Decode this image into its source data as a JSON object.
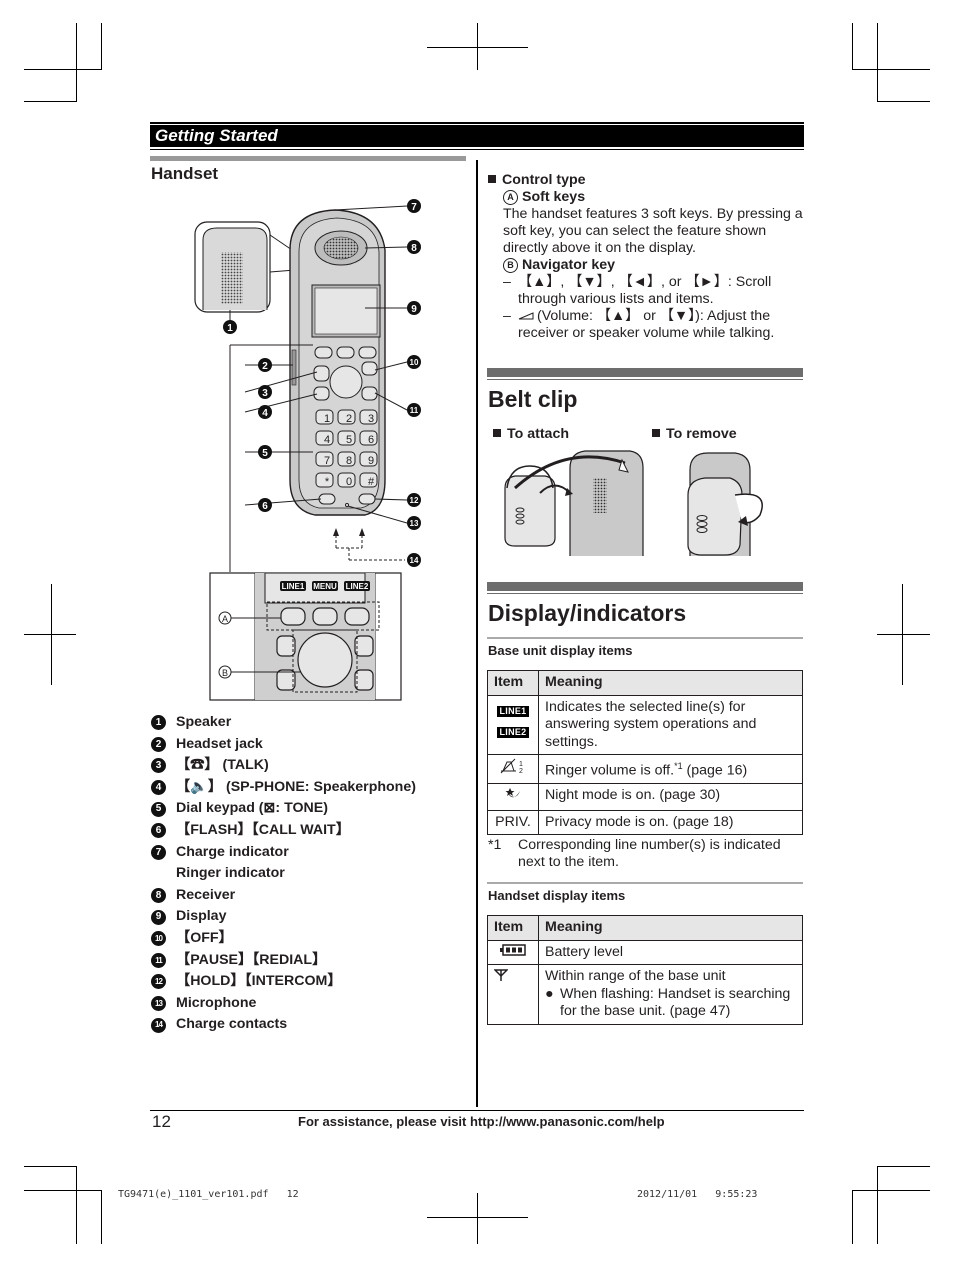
{
  "header": {
    "section": "Getting Started"
  },
  "handset": {
    "title": "Handset",
    "diagram_callouts": [
      "1",
      "2",
      "3",
      "4",
      "5",
      "6",
      "7",
      "8",
      "9",
      "10",
      "11",
      "12",
      "13",
      "14"
    ],
    "inset_labels": {
      "a": "A",
      "b": "B",
      "soft_keys": [
        "LINE1",
        "MENU",
        "LINE2"
      ]
    },
    "parts": [
      {
        "n": "1",
        "label": "Speaker"
      },
      {
        "n": "2",
        "label": "Headset jack"
      },
      {
        "n": "3",
        "label": "【☎】 (TALK)"
      },
      {
        "n": "4",
        "label": "【🔈】 (SP-PHONE: Speakerphone)"
      },
      {
        "n": "5",
        "label": "Dial keypad (⊠: TONE)"
      },
      {
        "n": "6",
        "label": "【FLASH】【CALL WAIT】"
      },
      {
        "n": "7",
        "label": "Charge indicator",
        "label2": "Ringer indicator"
      },
      {
        "n": "8",
        "label": "Receiver"
      },
      {
        "n": "9",
        "label": "Display"
      },
      {
        "n": "10",
        "label": "【OFF】"
      },
      {
        "n": "11",
        "label": "【PAUSE】【REDIAL】"
      },
      {
        "n": "12",
        "label": "【HOLD】【INTERCOM】"
      },
      {
        "n": "13",
        "label": "Microphone"
      },
      {
        "n": "14",
        "label": "Charge contacts"
      }
    ]
  },
  "control_type": {
    "heading": "Control type",
    "soft_keys": {
      "marker": "A",
      "title": "Soft keys",
      "text": "The handset features 3 soft keys. By pressing a soft key, you can select the feature shown directly above it on the display."
    },
    "navigator": {
      "marker": "B",
      "title": "Navigator key",
      "items": [
        "【▲】, 【▼】, 【◄】, or 【►】: Scroll through various lists and items.",
        "(Volume: 【▲】 or 【▼】): Adjust the receiver or speaker volume while talking."
      ]
    }
  },
  "belt_clip": {
    "title": "Belt clip",
    "attach": "To attach",
    "remove": "To remove"
  },
  "display_indicators": {
    "title": "Display/indicators",
    "base_unit": {
      "heading": "Base unit display items",
      "columns": [
        "Item",
        "Meaning"
      ],
      "rows": [
        {
          "item": [
            "LINE1",
            "LINE2"
          ],
          "meaning": "Indicates the selected line(s) for answering system operations and settings."
        },
        {
          "item": "ringer-off-icon",
          "meaning": "Ringer volume is off.",
          "sup": "*1",
          "ref": " (page 16)"
        },
        {
          "item": "night-mode-icon",
          "meaning": "Night mode is on. (page 30)"
        },
        {
          "item": "PRIV.",
          "meaning": "Privacy mode is on. (page 18)"
        }
      ],
      "footnote_mark": "*1",
      "footnote": "Corresponding line number(s) is indicated next to the item."
    },
    "handset": {
      "heading": "Handset display items",
      "columns": [
        "Item",
        "Meaning"
      ],
      "rows": [
        {
          "item": "battery-icon",
          "meaning": "Battery level"
        },
        {
          "item": "antenna-icon",
          "meaning": "Within range of the base unit",
          "bullet": "When flashing: Handset is searching for the base unit. (page 47)"
        }
      ]
    }
  },
  "footer": {
    "page_number": "12",
    "assistance": "For assistance, please visit http://www.panasonic.com/help"
  },
  "print_meta": {
    "file": "TG9471(e)_1101_ver101.pdf",
    "page": "12",
    "date": "2012/11/01",
    "time": "9:55:23"
  }
}
